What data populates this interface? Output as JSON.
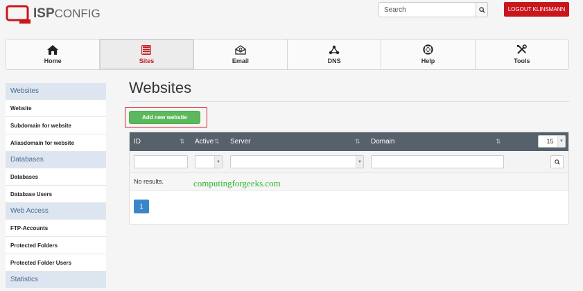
{
  "header": {
    "logo_bold": "ISP",
    "logo_rest": "CONFIG",
    "search_placeholder": "Search",
    "logout_label": "LOGOUT KLINSMANN"
  },
  "nav": {
    "tabs": [
      {
        "label": "Home",
        "icon": "home-icon",
        "active": false
      },
      {
        "label": "Sites",
        "icon": "sites-icon",
        "active": true
      },
      {
        "label": "Email",
        "icon": "email-icon",
        "active": false
      },
      {
        "label": "DNS",
        "icon": "dns-icon",
        "active": false
      },
      {
        "label": "Help",
        "icon": "help-icon",
        "active": false
      },
      {
        "label": "Tools",
        "icon": "tools-icon",
        "active": false
      }
    ]
  },
  "sidebar": {
    "sections": [
      {
        "title": "Websites",
        "items": [
          "Website",
          "Subdomain for website",
          "Aliasdomain for website"
        ]
      },
      {
        "title": "Databases",
        "items": [
          "Databases",
          "Database Users"
        ]
      },
      {
        "title": "Web Access",
        "items": [
          "FTP-Accounts",
          "Protected Folders",
          "Protected Folder Users"
        ]
      },
      {
        "title": "Statistics",
        "items": []
      }
    ]
  },
  "main": {
    "title": "Websites",
    "add_button": "Add new website",
    "table": {
      "columns": [
        "ID",
        "Active",
        "Server",
        "Domain"
      ],
      "per_page": "15",
      "empty_text": "No results.",
      "current_page": "1"
    },
    "watermark": "computingforgeeks.com"
  },
  "colors": {
    "brand_red": "#c9161b",
    "add_green": "#5cb85c",
    "table_header": "#56616b",
    "pager_blue": "#3a87c8",
    "sidebar_head": "#dde6f0"
  }
}
